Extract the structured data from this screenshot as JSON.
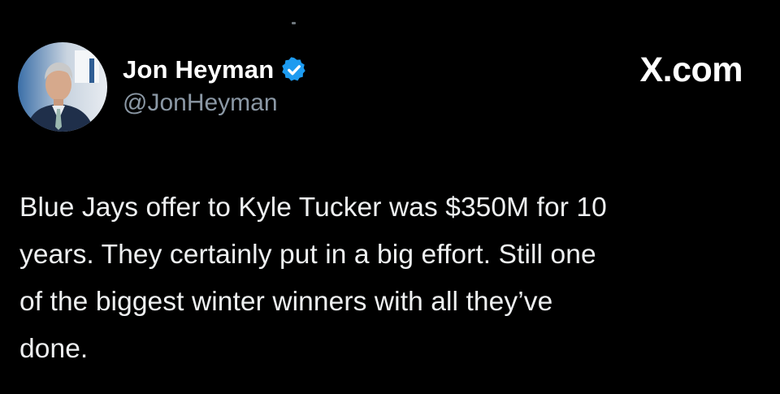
{
  "author": {
    "display_name": "Jon Heyman",
    "handle": "@JonHeyman",
    "verified": true,
    "avatar_icon": "profile-photo",
    "verified_icon": "verified-badge-icon",
    "verified_color": "#1d9bf0"
  },
  "brand": {
    "label": "X.com"
  },
  "tweet": {
    "lines": [
      "Blue Jays offer to Kyle Tucker was $350M for 10",
      "years. They certainly put in a big effort. Still one",
      "of the biggest winter winners with all they’ve",
      "done."
    ]
  },
  "colors": {
    "background": "#000000",
    "name": "#ffffff",
    "handle": "#8b98a5",
    "text": "#eef0f1"
  }
}
